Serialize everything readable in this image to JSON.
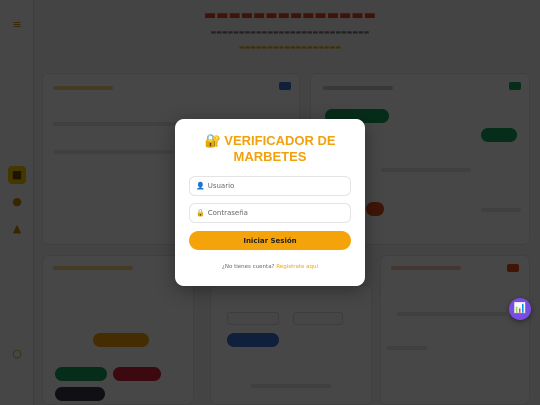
{
  "modal": {
    "icon": "🔐",
    "title": "VERIFICADOR DE MARBETES",
    "username_placeholder": "Usuario",
    "username_value": "",
    "password_placeholder": "Contraseña",
    "password_value": "",
    "login_label": "Iniciar Sesión",
    "register_prompt": "¿No tienes cuenta?",
    "register_link": "Regístrate aquí"
  },
  "icons": {
    "user": "👤",
    "lock": "🔒",
    "fab": "📊"
  },
  "colors": {
    "accent": "#f5a30b",
    "title": "#f0a10c",
    "fab": "#7b4be6"
  }
}
